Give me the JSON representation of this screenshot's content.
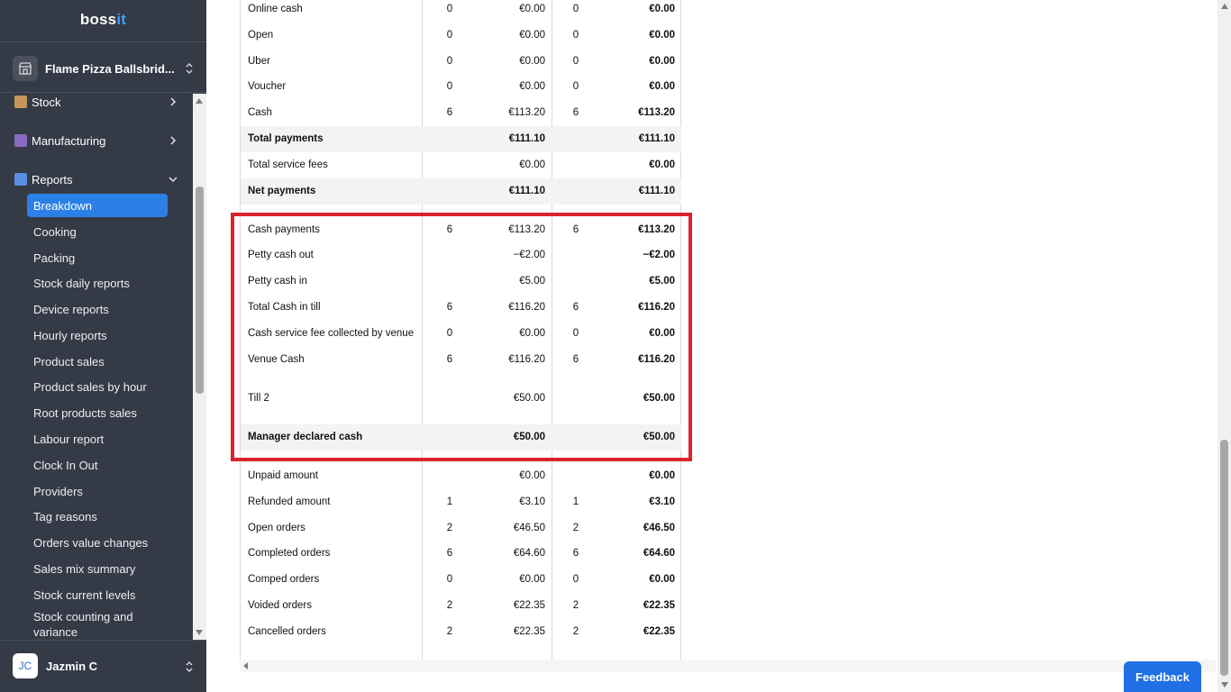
{
  "brand": {
    "part1": "boss",
    "part2": "it"
  },
  "venue": {
    "name": "Flame Pizza Ballsbrid..."
  },
  "nav": {
    "sections": [
      {
        "label": "Stock",
        "icon": "box-icon"
      },
      {
        "label": "Manufacturing",
        "icon": "factory-icon"
      },
      {
        "label": "Reports",
        "icon": "bar-chart-icon"
      }
    ],
    "report_items": [
      "Breakdown",
      "Cooking",
      "Packing",
      "Stock daily reports",
      "Device reports",
      "Hourly reports",
      "Product sales",
      "Product sales by hour",
      "Root products sales",
      "Labour report",
      "Clock In Out",
      "Providers",
      "Tag reasons",
      "Orders value changes",
      "Sales mix summary",
      "Stock current levels",
      "Stock counting and variance"
    ],
    "active_item": "Breakdown"
  },
  "user": {
    "initials": "JC",
    "name": "Jazmin C"
  },
  "table": {
    "rows": [
      [
        "Online cash",
        "0",
        "€0.00",
        "0",
        "€0.00"
      ],
      [
        "Open",
        "0",
        "€0.00",
        "0",
        "€0.00"
      ],
      [
        "Uber",
        "0",
        "€0.00",
        "0",
        "€0.00"
      ],
      [
        "Voucher",
        "0",
        "€0.00",
        "0",
        "€0.00"
      ],
      [
        "Cash",
        "6",
        "€113.20",
        "6",
        "€113.20"
      ],
      [
        "Total payments",
        "",
        "€111.10",
        "",
        "€111.10"
      ],
      [
        "Total service fees",
        "",
        "€0.00",
        "",
        "€0.00"
      ],
      [
        "Net payments",
        "",
        "€111.10",
        "",
        "€111.10"
      ],
      [
        "Cash payments",
        "6",
        "€113.20",
        "6",
        "€113.20"
      ],
      [
        "Petty cash out",
        "",
        "−€2.00",
        "",
        "−€2.00"
      ],
      [
        "Petty cash in",
        "",
        "€5.00",
        "",
        "€5.00"
      ],
      [
        "Total Cash in till",
        "6",
        "€116.20",
        "6",
        "€116.20"
      ],
      [
        "Cash service fee collected by venue",
        "0",
        "€0.00",
        "0",
        "€0.00"
      ],
      [
        "Venue Cash",
        "6",
        "€116.20",
        "6",
        "€116.20"
      ],
      [
        "Till 2",
        "",
        "€50.00",
        "",
        "€50.00"
      ],
      [
        "Manager declared cash",
        "",
        "€50.00",
        "",
        "€50.00"
      ],
      [
        "Unpaid amount",
        "",
        "€0.00",
        "",
        "€0.00"
      ],
      [
        "Refunded amount",
        "1",
        "€3.10",
        "1",
        "€3.10"
      ],
      [
        "Open orders",
        "2",
        "€46.50",
        "2",
        "€46.50"
      ],
      [
        "Completed orders",
        "6",
        "€64.60",
        "6",
        "€64.60"
      ],
      [
        "Comped orders",
        "0",
        "€0.00",
        "0",
        "€0.00"
      ],
      [
        "Voided orders",
        "2",
        "€22.35",
        "2",
        "€22.35"
      ],
      [
        "Cancelled orders",
        "2",
        "€22.35",
        "2",
        "€22.35"
      ]
    ]
  },
  "feedback_label": "Feedback",
  "colors": {
    "sidebar": "#343a46",
    "active": "#2b80e8",
    "highlight": "#d9232d",
    "feedback": "#1f6fe5"
  }
}
